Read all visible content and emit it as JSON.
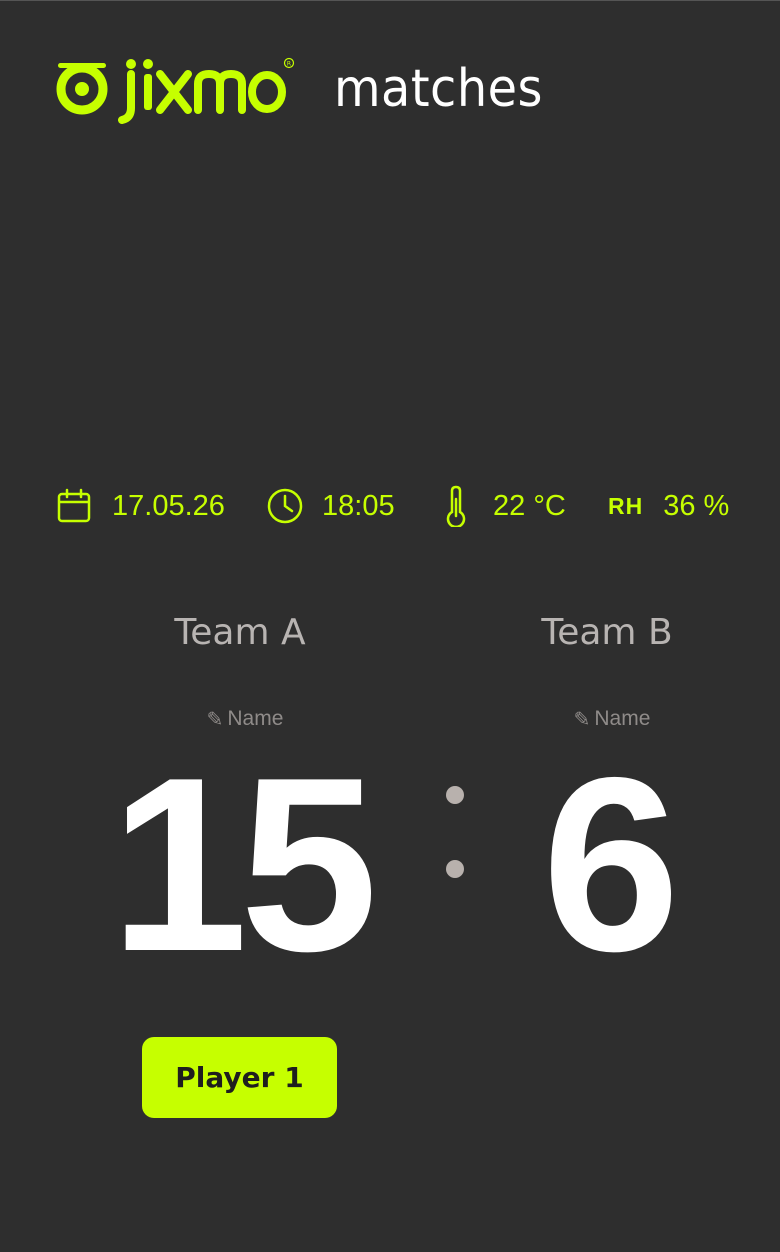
{
  "header": {
    "logo_text": "jixmo",
    "app_title": "matches"
  },
  "info": {
    "date": "17.05.26",
    "time": "18:05",
    "temperature": "22 °C",
    "humidity_label": "RH",
    "humidity": "36 %"
  },
  "teams": [
    {
      "label": "Team A",
      "name_placeholder": "Name",
      "score": "15"
    },
    {
      "label": "Team B",
      "name_placeholder": "Name",
      "score": "6"
    }
  ],
  "player_button": {
    "label": "Player 1"
  },
  "icons": {
    "pencil": "✎",
    "date": "calendar-icon",
    "time": "clock-icon",
    "temperature": "thermometer-icon"
  },
  "colors": {
    "accent": "#c6ff00",
    "background": "#2e2e2e",
    "muted_text": "#b8b4b2",
    "score_text": "#ffffff"
  }
}
